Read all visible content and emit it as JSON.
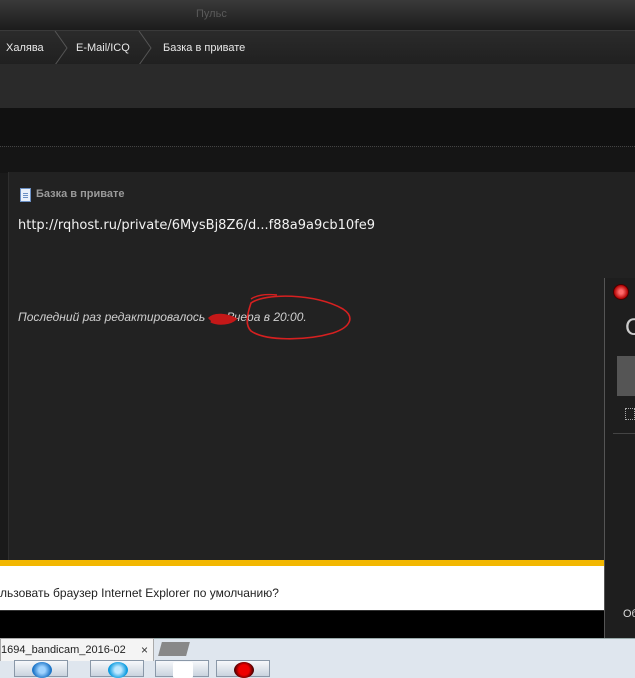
{
  "window": {
    "title": "Пульс"
  },
  "breadcrumb": {
    "items": [
      "Халява",
      "E-Mail/ICQ",
      "Базка в привате"
    ]
  },
  "post": {
    "title": "Базка в привате",
    "link": "http://rqhost.ru/private/6MysBj8Z6/d...f88a9a9cb10fe9",
    "edited_prefix": "Последний раз редактировалось",
    "edited_time": "Вчера в 20:00."
  },
  "ie_bar": {
    "text": "льзовать браузер Internet Explorer по умолчанию?"
  },
  "side_panel": {
    "big_letter": "С",
    "label": "Об"
  },
  "tabs": {
    "active_label": "1694_bandicam_2016-02",
    "close": "×"
  },
  "taskbar": {
    "icons": [
      "internet-explorer-icon",
      "skype-icon",
      "yandex-icon",
      "record-icon"
    ]
  },
  "colors": {
    "ie_bar_accent": "#f2b701",
    "annotation": "#d62020"
  }
}
